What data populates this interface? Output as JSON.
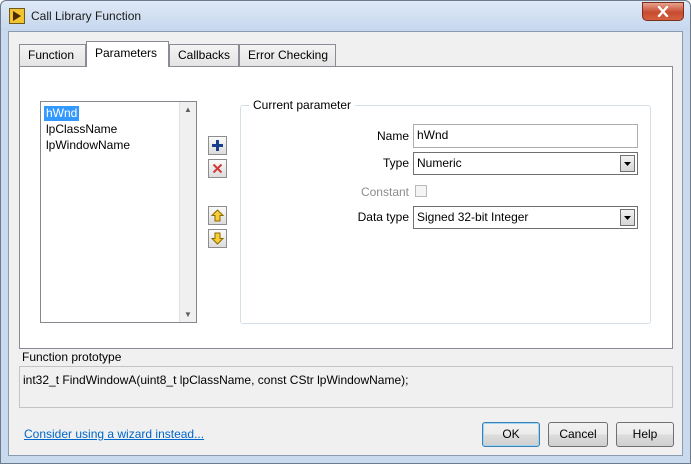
{
  "window": {
    "title": "Call Library Function"
  },
  "tabs": [
    {
      "label": "Function"
    },
    {
      "label": "Parameters"
    },
    {
      "label": "Callbacks"
    },
    {
      "label": "Error Checking"
    }
  ],
  "parameters": {
    "list": [
      "hWnd",
      "lpClassName",
      "lpWindowName"
    ],
    "selected_index": 0
  },
  "current_parameter": {
    "group_title": "Current parameter",
    "name_label": "Name",
    "name_value": "hWnd",
    "type_label": "Type",
    "type_value": "Numeric",
    "constant_label": "Constant",
    "constant_checked": false,
    "data_type_label": "Data type",
    "data_type_value": "Signed 32-bit Integer"
  },
  "prototype": {
    "label": "Function prototype",
    "text": "int32_t FindWindowA(uint8_t lpClassName, const CStr lpWindowName);"
  },
  "footer": {
    "wizard_link": "Consider using a wizard instead...",
    "ok_label": "OK",
    "cancel_label": "Cancel",
    "help_label": "Help"
  },
  "colors": {
    "selection": "#3399ff",
    "link": "#0066cc",
    "close_button": "#c74b30",
    "add_icon": "#1a3e8c",
    "remove_icon": "#d23a3a",
    "arrow_icon": "#e5b100"
  },
  "icons": [
    "labview-app-icon",
    "close-icon",
    "plus-icon",
    "delete-icon",
    "arrow-up-icon",
    "arrow-down-icon",
    "chevron-down-icon"
  ]
}
